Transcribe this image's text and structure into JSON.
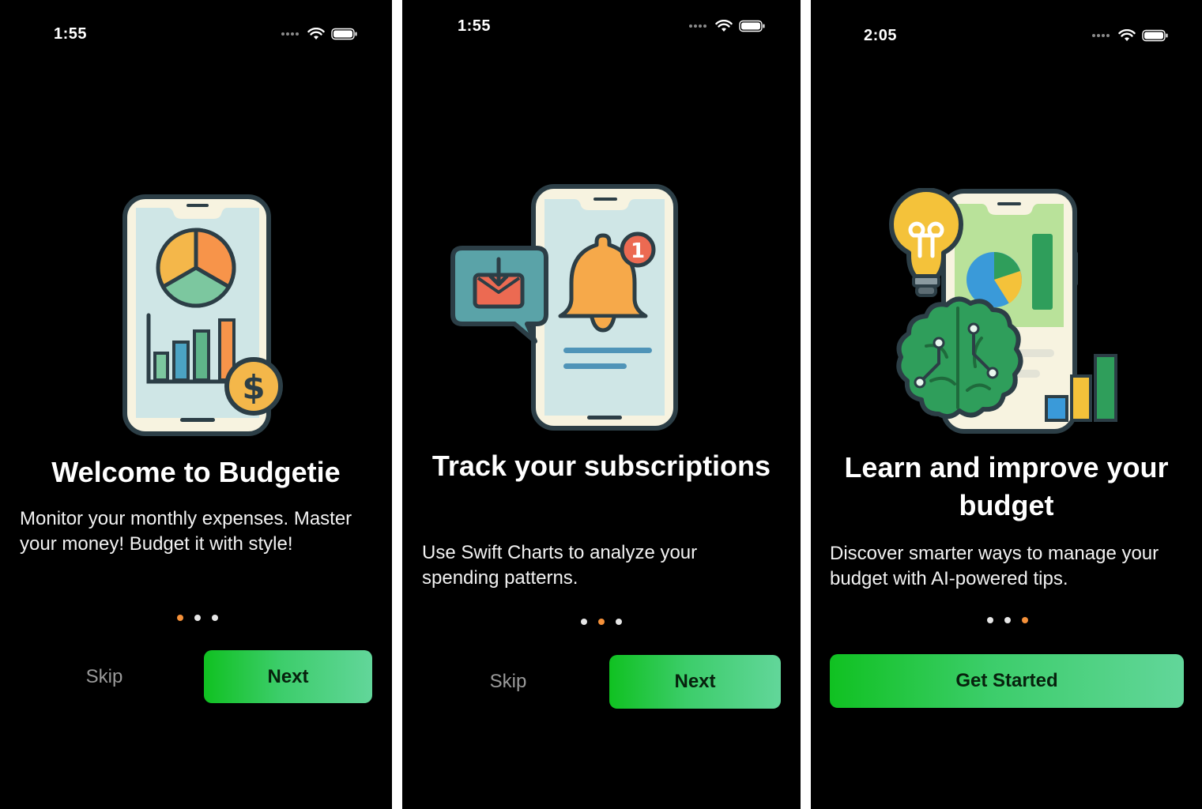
{
  "screens": [
    {
      "time": "1:55",
      "title": "Welcome to Budgetie",
      "description": "Monitor your monthly expenses. Master your money! Budget it with style!",
      "skip_label": "Skip",
      "cta_label": "Next",
      "illustration": "phone-pie-chart-dollar",
      "page_index": 1,
      "page_count": 3
    },
    {
      "time": "1:55",
      "title": "Track your subscriptions",
      "description": "Use Swift Charts to analyze your spending patterns.",
      "skip_label": "Skip",
      "cta_label": "Next",
      "illustration": "phone-bell-notification",
      "notification_badge": "1",
      "page_index": 2,
      "page_count": 3
    },
    {
      "time": "2:05",
      "title": "Learn and improve your budget",
      "description": "Discover smarter ways to manage your budget with AI-powered tips.",
      "cta_label": "Get Started",
      "illustration": "lightbulb-brain-phone",
      "page_index": 3,
      "page_count": 3
    }
  ],
  "colors": {
    "background": "#000000",
    "accent_dot": "#f5913a",
    "cta_gradient_start": "#10c121",
    "cta_gradient_end": "#62d69a",
    "skip_text": "#9a9a9a"
  }
}
